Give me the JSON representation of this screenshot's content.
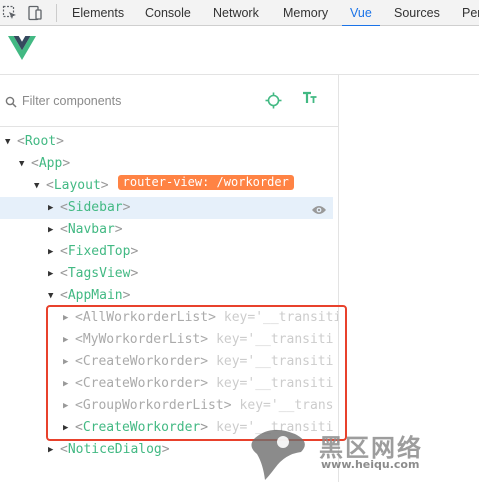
{
  "devtools": {
    "tabs": [
      "Elements",
      "Console",
      "Network",
      "Memory",
      "Vue",
      "Sources",
      "Per"
    ],
    "active_tab": "Vue"
  },
  "filter": {
    "placeholder": "Filter components"
  },
  "tree": {
    "rows": [
      {
        "name": "Root",
        "arrow": "down"
      },
      {
        "name": "App",
        "arrow": "down"
      },
      {
        "name": "Layout",
        "arrow": "down",
        "badge": "router-view: /workorder"
      },
      {
        "name": "Sidebar",
        "arrow": "right",
        "selected": true
      },
      {
        "name": "Navbar",
        "arrow": "right"
      },
      {
        "name": "FixedTop",
        "arrow": "right"
      },
      {
        "name": "TagsView",
        "arrow": "right"
      },
      {
        "name": "AppMain",
        "arrow": "down"
      },
      {
        "name": "AllWorkorderList",
        "arrow": "right",
        "key": "key='__transiti",
        "dim": true
      },
      {
        "name": "MyWorkorderList",
        "arrow": "right",
        "key": "key='__transiti",
        "dim": true
      },
      {
        "name": "CreateWorkorder",
        "arrow": "right",
        "key": "key='__transiti",
        "dim": true
      },
      {
        "name": "CreateWorkorder",
        "arrow": "right",
        "key": "key='__transiti",
        "dim": true
      },
      {
        "name": "GroupWorkorderList",
        "arrow": "right",
        "key": "key='__trans",
        "dim": true
      },
      {
        "name": "CreateWorkorder",
        "arrow": "right",
        "key": "key='__transiti"
      },
      {
        "name": "NoticeDialog",
        "arrow": "right"
      }
    ]
  },
  "watermark": {
    "text": "黑区网络",
    "url": "www.heiqu.com"
  },
  "colors": {
    "vue_green": "#42b983",
    "badge_orange": "#ff8344",
    "highlight_red": "#e8412c",
    "active_tab_blue": "#1a73e8"
  }
}
